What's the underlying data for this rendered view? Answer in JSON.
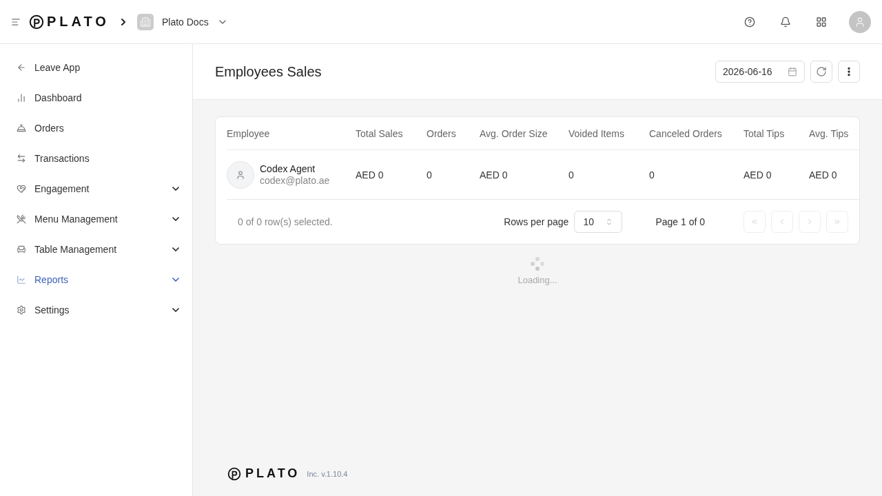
{
  "header": {
    "brand": "PLATO",
    "workspace": "Plato Docs"
  },
  "sidebar": {
    "items": [
      {
        "label": "Leave App",
        "selected": false,
        "collapsible": false
      },
      {
        "label": "Dashboard",
        "selected": false,
        "collapsible": false
      },
      {
        "label": "Orders",
        "selected": false,
        "collapsible": false
      },
      {
        "label": "Transactions",
        "selected": false,
        "collapsible": false
      },
      {
        "label": "Engagement",
        "selected": false,
        "collapsible": true
      },
      {
        "label": "Menu Management",
        "selected": false,
        "collapsible": true
      },
      {
        "label": "Table Management",
        "selected": false,
        "collapsible": true
      },
      {
        "label": "Reports",
        "selected": true,
        "collapsible": true
      },
      {
        "label": "Settings",
        "selected": false,
        "collapsible": true
      }
    ]
  },
  "page": {
    "title": "Employees Sales",
    "date": "2026-06-16"
  },
  "table": {
    "columns": [
      "Employee",
      "Total Sales",
      "Orders",
      "Avg. Order Size",
      "Voided Items",
      "Canceled Orders",
      "Total Tips",
      "Avg. Tips"
    ],
    "rows": [
      {
        "cells": [
          {
            "name": "Codex Agent",
            "email": "codex@plato.ae"
          },
          "AED 0",
          "0",
          "AED 0",
          "0",
          "0",
          "AED 0",
          "AED 0"
        ]
      }
    ]
  },
  "pagination": {
    "selection": "0 of 0 row(s) selected.",
    "rows_label": "Rows per page",
    "rows_value": "10",
    "page": "Page 1 of 0",
    "buttons": [
      {
        "disabled": true
      },
      {
        "disabled": true
      },
      {
        "disabled": true
      },
      {
        "disabled": true
      }
    ]
  },
  "loading": "Loading...",
  "footer": {
    "brand": "PLATO",
    "version": "Inc. v.1.10.4"
  }
}
